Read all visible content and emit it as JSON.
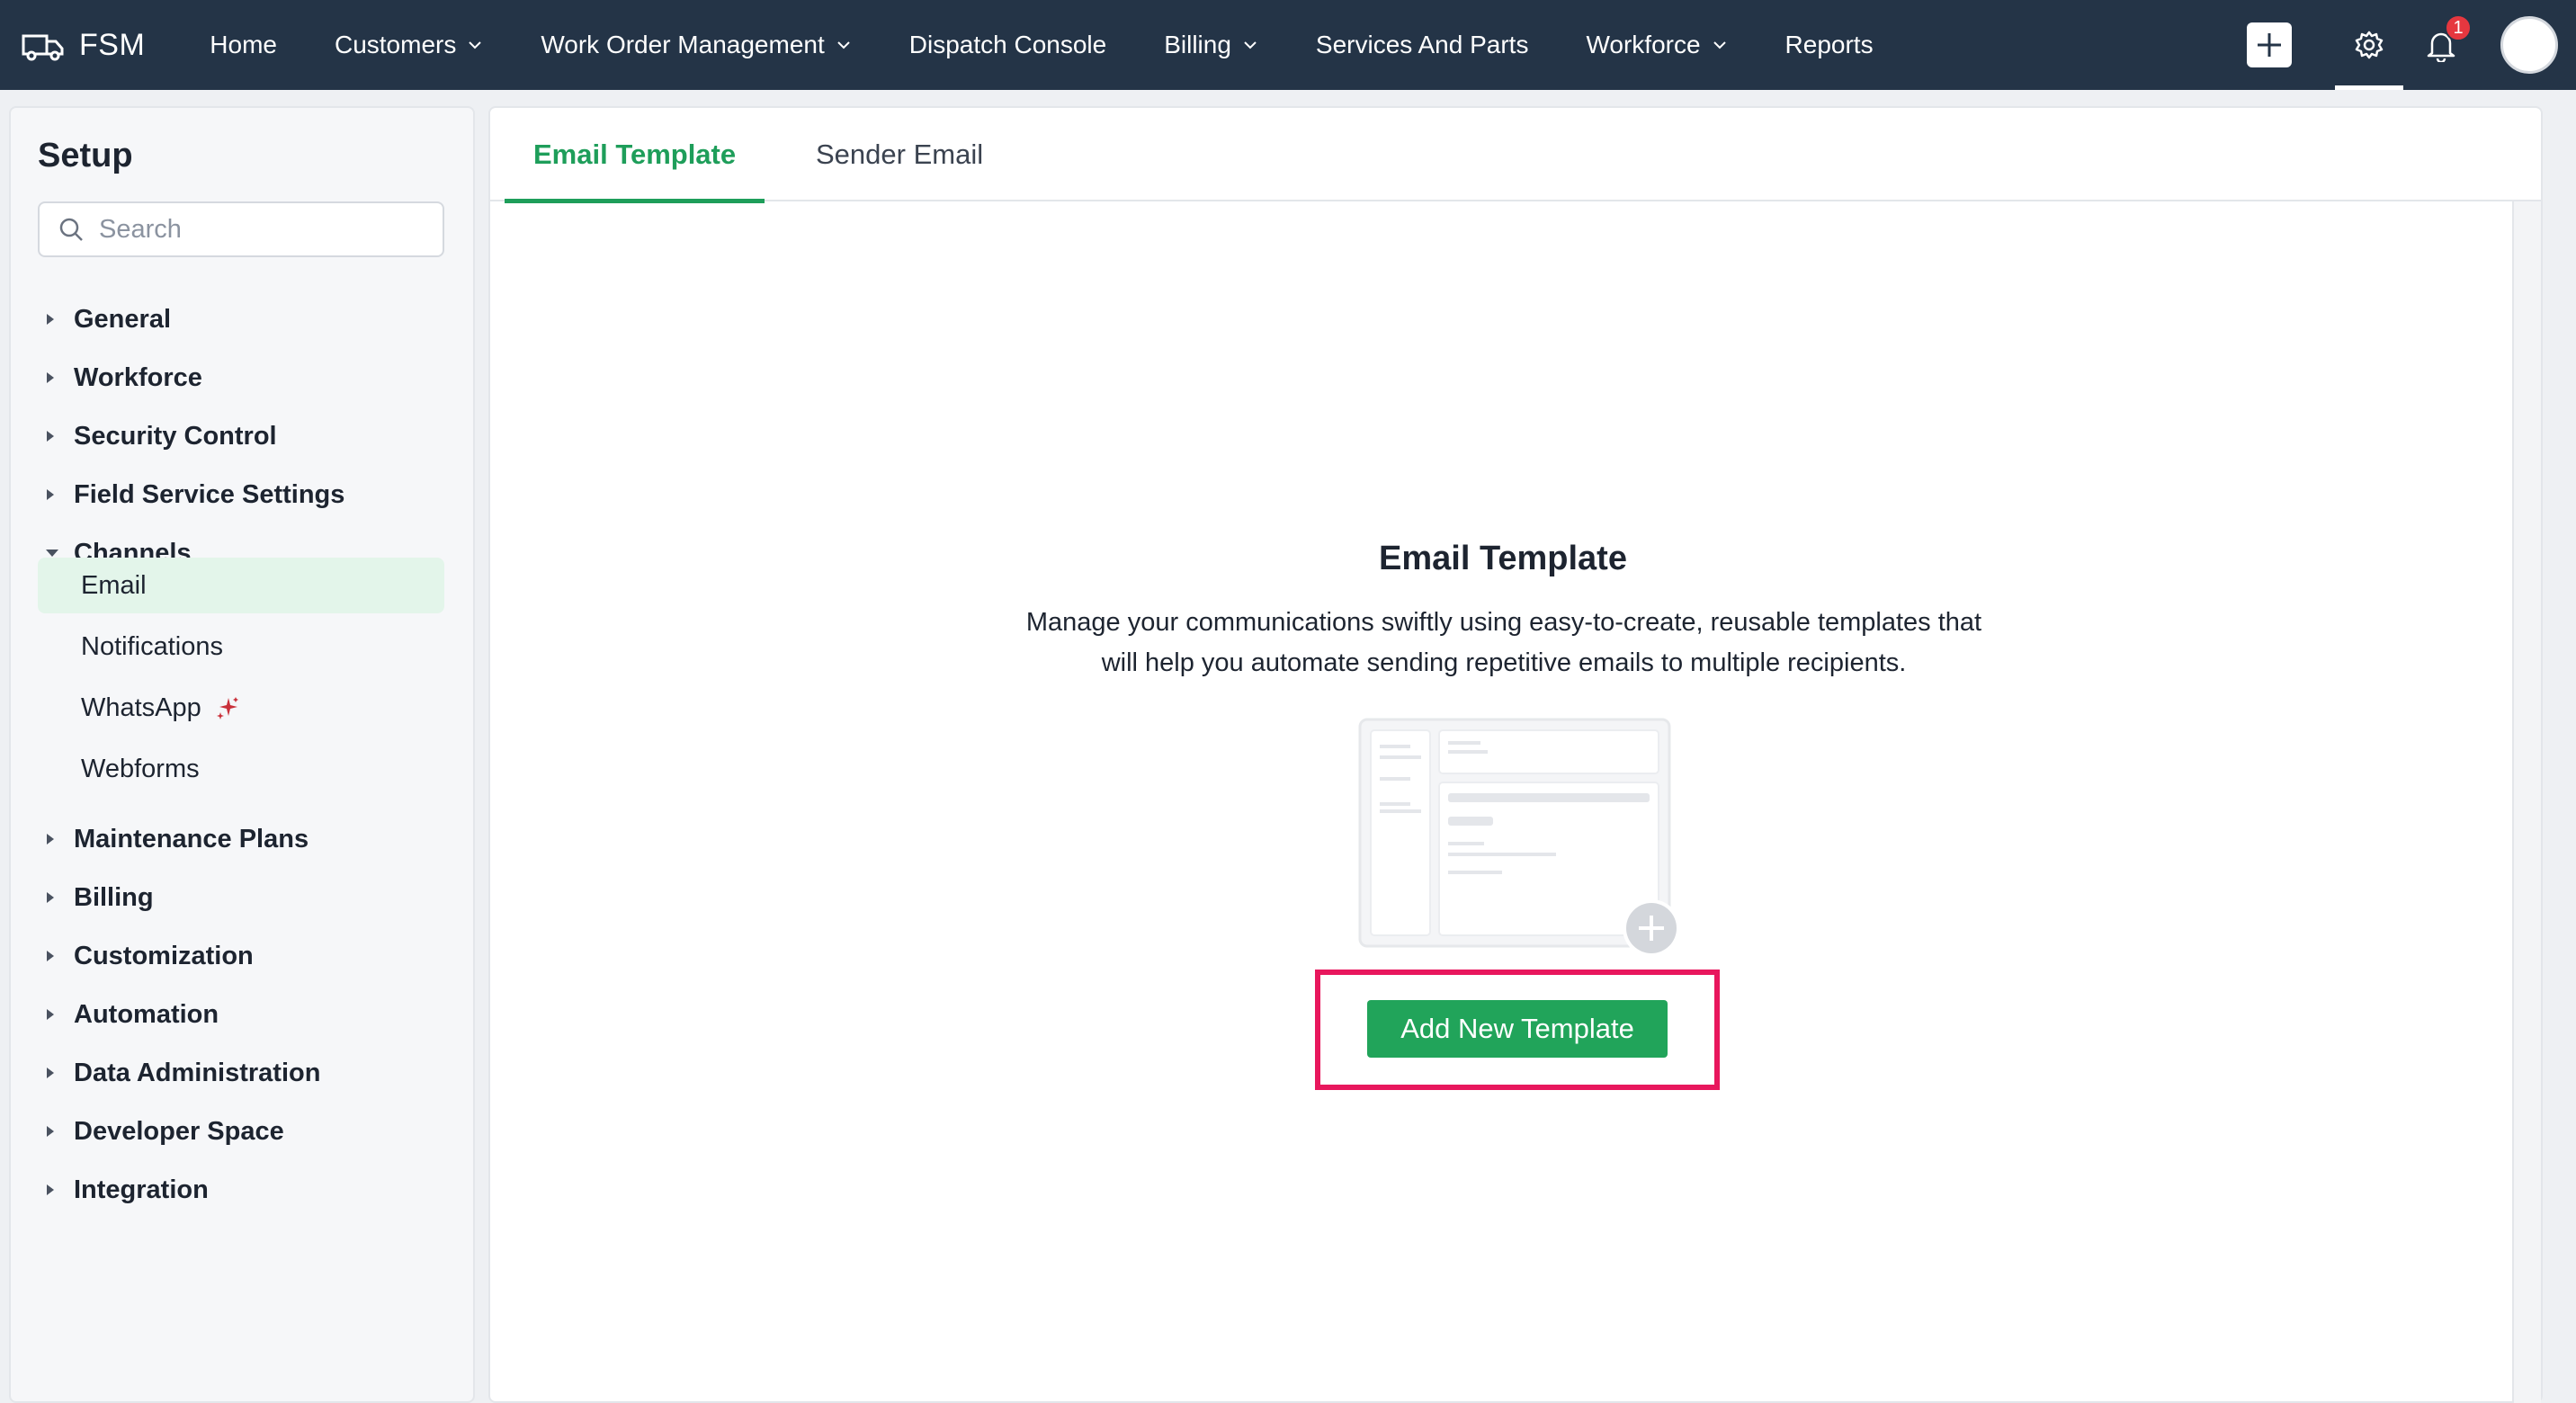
{
  "topbar": {
    "brand": "FSM",
    "nav": [
      {
        "label": "Home",
        "has_dropdown": false
      },
      {
        "label": "Customers",
        "has_dropdown": true
      },
      {
        "label": "Work Order Management",
        "has_dropdown": true
      },
      {
        "label": "Dispatch Console",
        "has_dropdown": false
      },
      {
        "label": "Billing",
        "has_dropdown": true
      },
      {
        "label": "Services And Parts",
        "has_dropdown": false
      },
      {
        "label": "Workforce",
        "has_dropdown": true
      },
      {
        "label": "Reports",
        "has_dropdown": false
      }
    ],
    "notification_count": "1",
    "icons": [
      "plus-icon",
      "gear-icon",
      "bell-icon",
      "avatar"
    ]
  },
  "sidebar": {
    "title": "Setup",
    "search_placeholder": "Search",
    "groups_before": [
      "General",
      "Workforce",
      "Security Control",
      "Field Service Settings"
    ],
    "expanded_group": "Channels",
    "channel_items": [
      "Email",
      "Notifications",
      "WhatsApp",
      "Webforms"
    ],
    "selected_item": "Email",
    "groups_after": [
      "Maintenance Plans",
      "Billing",
      "Customization",
      "Automation",
      "Data Administration",
      "Developer Space",
      "Integration"
    ]
  },
  "main": {
    "tabs": [
      {
        "label": "Email Template",
        "active": true
      },
      {
        "label": "Sender Email",
        "active": false
      }
    ],
    "empty_state": {
      "title": "Email Template",
      "description_line1": "Manage your communications swiftly using easy-to-create, reusable templates that",
      "description_line2": "will help you automate sending repetitive emails to multiple recipients.",
      "button_label": "Add New Template"
    }
  },
  "colors": {
    "topbar": "#243447",
    "accent_green": "#21a45a",
    "active_tab": "#1e9e5a",
    "highlight": "#e8175d",
    "selected_bg": "#e3f5ea",
    "badge": "#e6373f"
  }
}
